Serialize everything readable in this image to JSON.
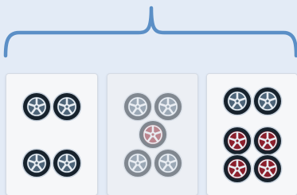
{
  "colors": {
    "background": "#e3ebf6",
    "brace": "#5b8fc6",
    "tire": "#17222c",
    "rim_dark": "#4d6478",
    "rim_red": "#8b1f2c",
    "spoke": "#e8edf2"
  },
  "panels": [
    {
      "state": "normal",
      "wheels": [
        "dark",
        "dark",
        "dark",
        "dark"
      ]
    },
    {
      "state": "faded",
      "wheels": [
        "dark",
        "dark",
        "red",
        "dark",
        "dark"
      ]
    },
    {
      "state": "normal",
      "wheels": [
        "dark",
        "dark",
        "red",
        "red",
        "red",
        "red"
      ]
    }
  ]
}
